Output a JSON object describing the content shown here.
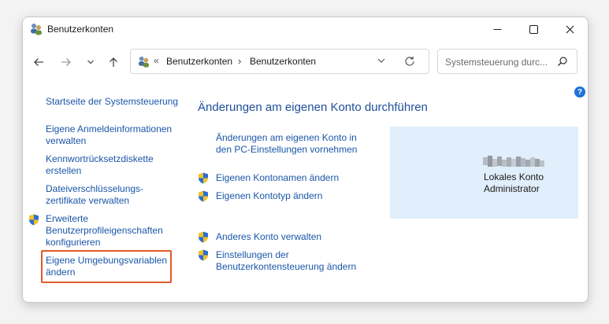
{
  "window": {
    "title": "Benutzerkonten"
  },
  "breadcrumb": {
    "overflow": "«",
    "items": [
      "Benutzerkonten",
      "Benutzerkonten"
    ]
  },
  "search": {
    "placeholder": "Systemsteuerung durc..."
  },
  "sidebar": {
    "home": "Startseite der Systemsteuerung",
    "items": [
      {
        "label": "Eigene Anmeldeinformationen verwalten"
      },
      {
        "label": "Kennwortrücksetzdiskette erstellen"
      },
      {
        "label": "Dateiverschlüsselungs-zertifikate verwalten"
      },
      {
        "label": "Erweiterte Benutzerprofileigenschaften konfigurieren"
      },
      {
        "label": "Eigene Umgebungsvariablen ändern"
      }
    ]
  },
  "main": {
    "heading": "Änderungen am eigenen Konto durchführen",
    "tasks": [
      "Änderungen am eigenen Konto in den PC-Einstellungen vornehmen",
      "Eigenen Kontonamen ändern",
      "Eigenen Kontotyp ändern",
      "Anderes Konto verwalten",
      "Einstellungen der Benutzerkontensteuerung ändern"
    ]
  },
  "user": {
    "name": "Lokales Konto",
    "role": "Administrator"
  },
  "colors": {
    "link": "#1a56a8",
    "heading": "#1e4e9a",
    "highlight": "#e05a2b",
    "panel": "#e1eefb"
  },
  "icons": [
    "users-icon",
    "uac-shield-icon",
    "help-icon",
    "search-icon",
    "refresh-icon"
  ]
}
